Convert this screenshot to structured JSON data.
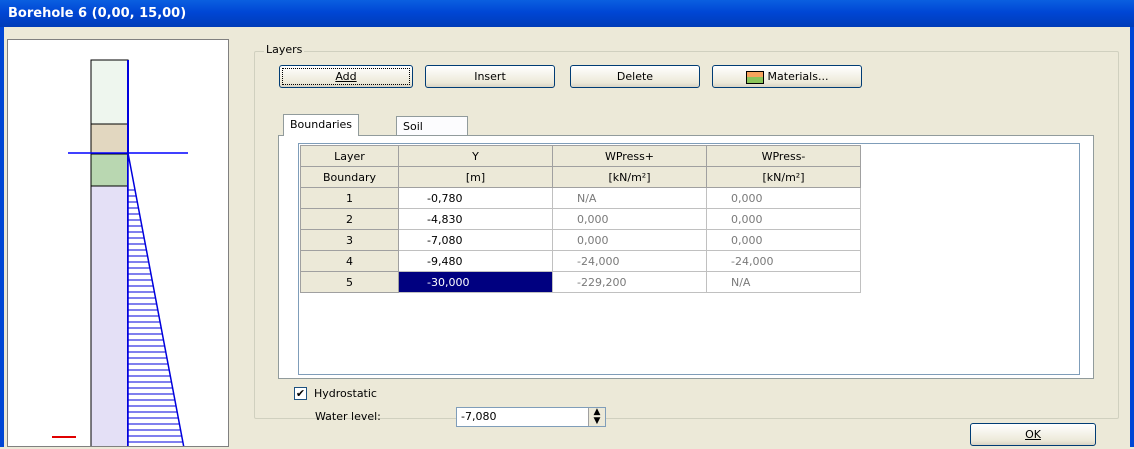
{
  "window": {
    "title": "Borehole 6 (0,00, 15,00)"
  },
  "layers_group": {
    "label": "Layers"
  },
  "toolbar": {
    "add_label": "Add",
    "insert_label": "Insert",
    "delete_label": "Delete",
    "materials_label": "Materials..."
  },
  "tabs": [
    {
      "label": "Boundaries",
      "active": true
    },
    {
      "label": "Soil",
      "active": false
    }
  ],
  "grid": {
    "headers": [
      {
        "line1": "Layer",
        "line2": "Boundary"
      },
      {
        "line1": "Y",
        "line2": "[m]"
      },
      {
        "line1": "WPress+",
        "line2": "[kN/m²]"
      },
      {
        "line1": "WPress-",
        "line2": "[kN/m²]"
      }
    ],
    "rows": [
      {
        "id": "1",
        "y": "-0,780",
        "wplus": "N/A",
        "wminus": "0,000"
      },
      {
        "id": "2",
        "y": "-4,830",
        "wplus": "0,000",
        "wminus": "0,000"
      },
      {
        "id": "3",
        "y": "-7,080",
        "wplus": "0,000",
        "wminus": "0,000"
      },
      {
        "id": "4",
        "y": "-9,480",
        "wplus": "-24,000",
        "wminus": "-24,000"
      },
      {
        "id": "5",
        "y": "-30,000",
        "wplus": "-229,200",
        "wminus": "N/A"
      }
    ],
    "selected_row": 5
  },
  "hydrostatic": {
    "label": "Hydrostatic",
    "checked": true
  },
  "water_level": {
    "label": "Water level:",
    "value": "-7,080"
  },
  "ok_label": "OK",
  "borehole_colors": {
    "layer1": "#eef6ee",
    "layer2": "#e2d7c0",
    "layer3": "#b9d7b1",
    "layer4": "#e4e0f6",
    "pressure": "#0000dd",
    "water_line": "#0000ff",
    "ground_marker": "#e00000"
  }
}
